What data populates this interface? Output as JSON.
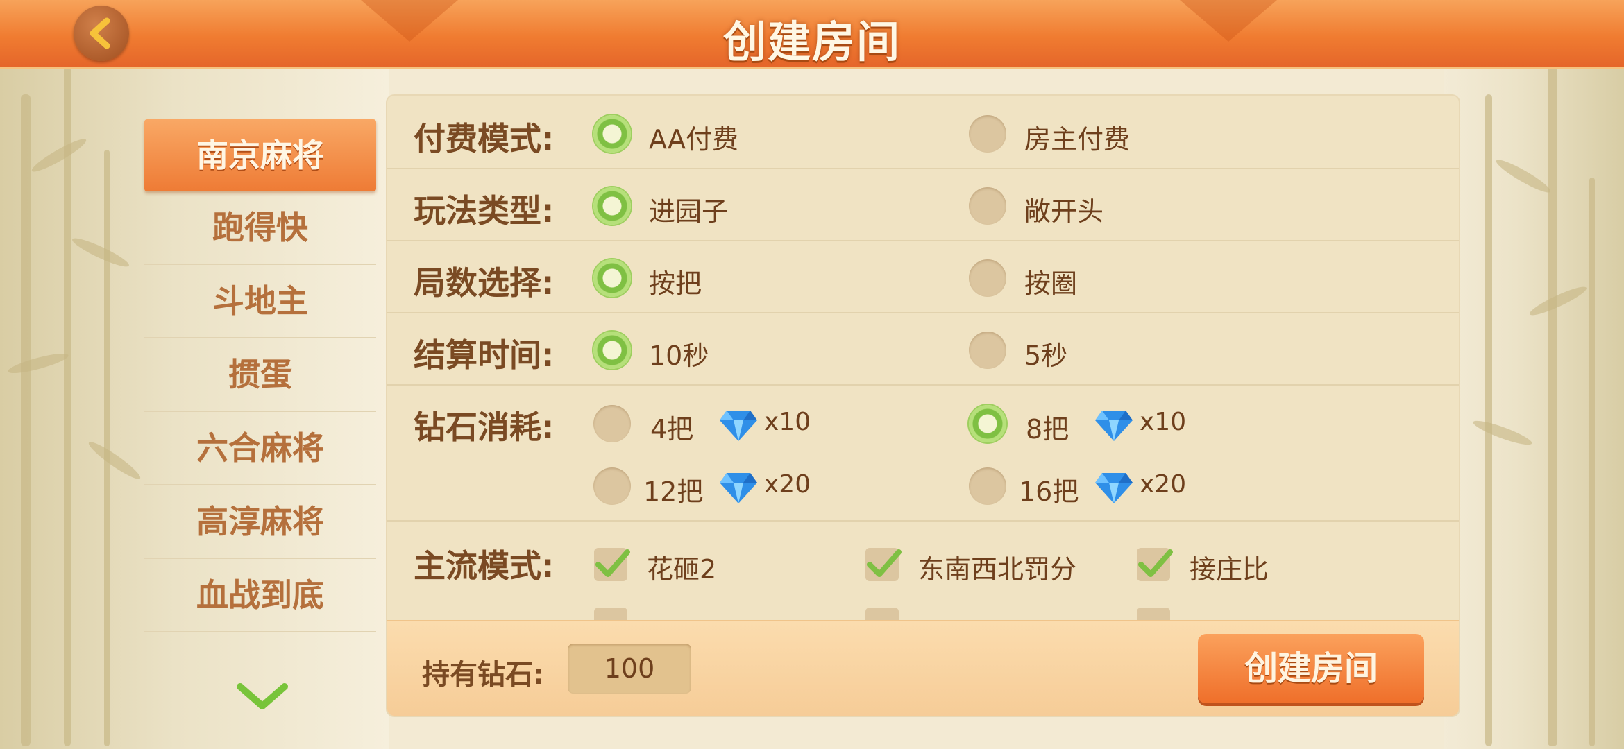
{
  "header": {
    "title": "创建房间",
    "back_icon": "back-arrow-icon"
  },
  "sidebar": {
    "items": [
      {
        "label": "南京麻将",
        "active": true
      },
      {
        "label": "跑得快",
        "active": false
      },
      {
        "label": "斗地主",
        "active": false
      },
      {
        "label": "掼蛋",
        "active": false
      },
      {
        "label": "六合麻将",
        "active": false
      },
      {
        "label": "高淳麻将",
        "active": false
      },
      {
        "label": "血战到底",
        "active": false
      }
    ],
    "scroll_icon": "chevron-down-icon"
  },
  "settings": {
    "payment": {
      "label": "付费模式:",
      "options": [
        {
          "text": "AA付费",
          "selected": true
        },
        {
          "text": "房主付费",
          "selected": false
        }
      ]
    },
    "gameplay": {
      "label": "玩法类型:",
      "options": [
        {
          "text": "进园子",
          "selected": true
        },
        {
          "text": "敞开头",
          "selected": false
        }
      ]
    },
    "rounds": {
      "label": "局数选择:",
      "options": [
        {
          "text": "按把",
          "selected": true
        },
        {
          "text": "按圈",
          "selected": false
        }
      ]
    },
    "settle_time": {
      "label": "结算时间:",
      "options": [
        {
          "text": "10秒",
          "selected": true
        },
        {
          "text": "5秒",
          "selected": false
        }
      ]
    },
    "diamond_cost": {
      "label": "钻石消耗:",
      "options": [
        {
          "text": "4把",
          "cost": "x10",
          "selected": false
        },
        {
          "text": "8把",
          "cost": "x10",
          "selected": true
        },
        {
          "text": "12把",
          "cost": "x20",
          "selected": false
        },
        {
          "text": "16把",
          "cost": "x20",
          "selected": false
        }
      ]
    },
    "mainstream": {
      "label": "主流模式:",
      "options": [
        {
          "text": "花砸2",
          "checked": true
        },
        {
          "text": "东南西北罚分",
          "checked": true
        },
        {
          "text": "接庄比",
          "checked": true
        }
      ]
    }
  },
  "footer": {
    "diamonds_label": "持有钻石:",
    "diamonds_value": "100",
    "create_button": "创建房间"
  },
  "colors": {
    "accent": "#ef7a33",
    "selected_radio": "#7fc043",
    "panel": "#f0e3c3",
    "text_brown": "#7a4a23"
  }
}
